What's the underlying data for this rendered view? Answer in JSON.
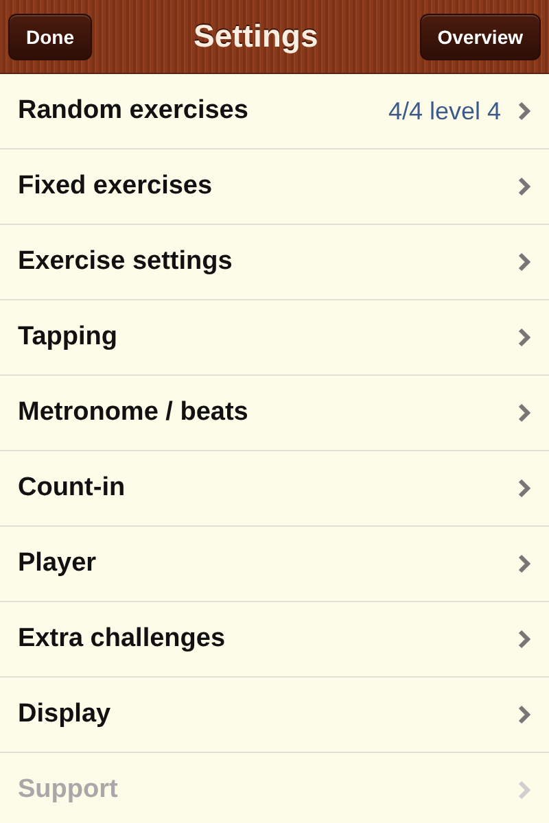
{
  "nav_bar": {
    "title": "Settings",
    "left_button": "Done",
    "right_button": "Overview"
  },
  "items": [
    {
      "label": "Random exercises",
      "detail": "4/4 level 4",
      "disabled": false
    },
    {
      "label": "Fixed exercises",
      "disabled": false
    },
    {
      "label": "Exercise settings",
      "disabled": false
    },
    {
      "label": "Tapping",
      "disabled": false
    },
    {
      "label": "Metronome / beats",
      "disabled": false
    },
    {
      "label": "Count-in",
      "disabled": false
    },
    {
      "label": "Player",
      "disabled": false
    },
    {
      "label": "Extra challenges",
      "disabled": false
    },
    {
      "label": "Display",
      "disabled": false
    },
    {
      "label": "Support",
      "disabled": true
    }
  ]
}
